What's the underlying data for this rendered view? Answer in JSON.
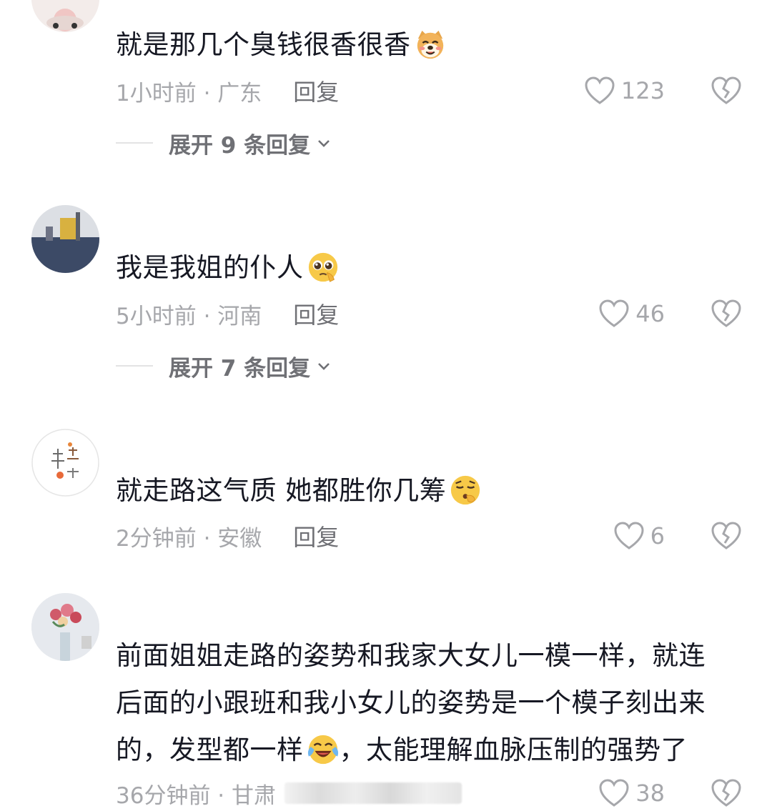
{
  "comments": [
    {
      "text": "就是那几个臭钱很香很香",
      "emoji": "dog-face",
      "time_location": "1小时前 · 广东",
      "reply_label": "回复",
      "like_count": "123",
      "expand_label": "展开 9 条回复"
    },
    {
      "text": "我是我姐的仆人",
      "emoji": "pleading-face",
      "time_location": "5小时前 · 河南",
      "reply_label": "回复",
      "like_count": "46",
      "expand_label": "展开 7 条回复"
    },
    {
      "text": "就走路这气质 她都胜你几筹",
      "emoji": "smug-face",
      "time_location": "2分钟前 · 安徽",
      "reply_label": "回复",
      "like_count": "6"
    },
    {
      "text_line1": "前面姐姐走路的姿势和我家大女儿一模一样，就连",
      "text_line2": "后面的小跟班和我小女儿的姿势是一个模子刻出来",
      "text_line3a": "的，发型都一样",
      "text_line3b": "，太能理解血脉压制的强势了",
      "emoji": "crying-laughing-face",
      "time_location": "36分钟前 · 甘肃",
      "like_count": "38"
    }
  ],
  "icons": {
    "like": "heart-outline-icon",
    "dislike": "broken-heart-icon",
    "expand": "chevron-down-icon"
  },
  "colors": {
    "text": "#161823",
    "meta": "#a6a7ab",
    "reply": "#6f7075"
  }
}
